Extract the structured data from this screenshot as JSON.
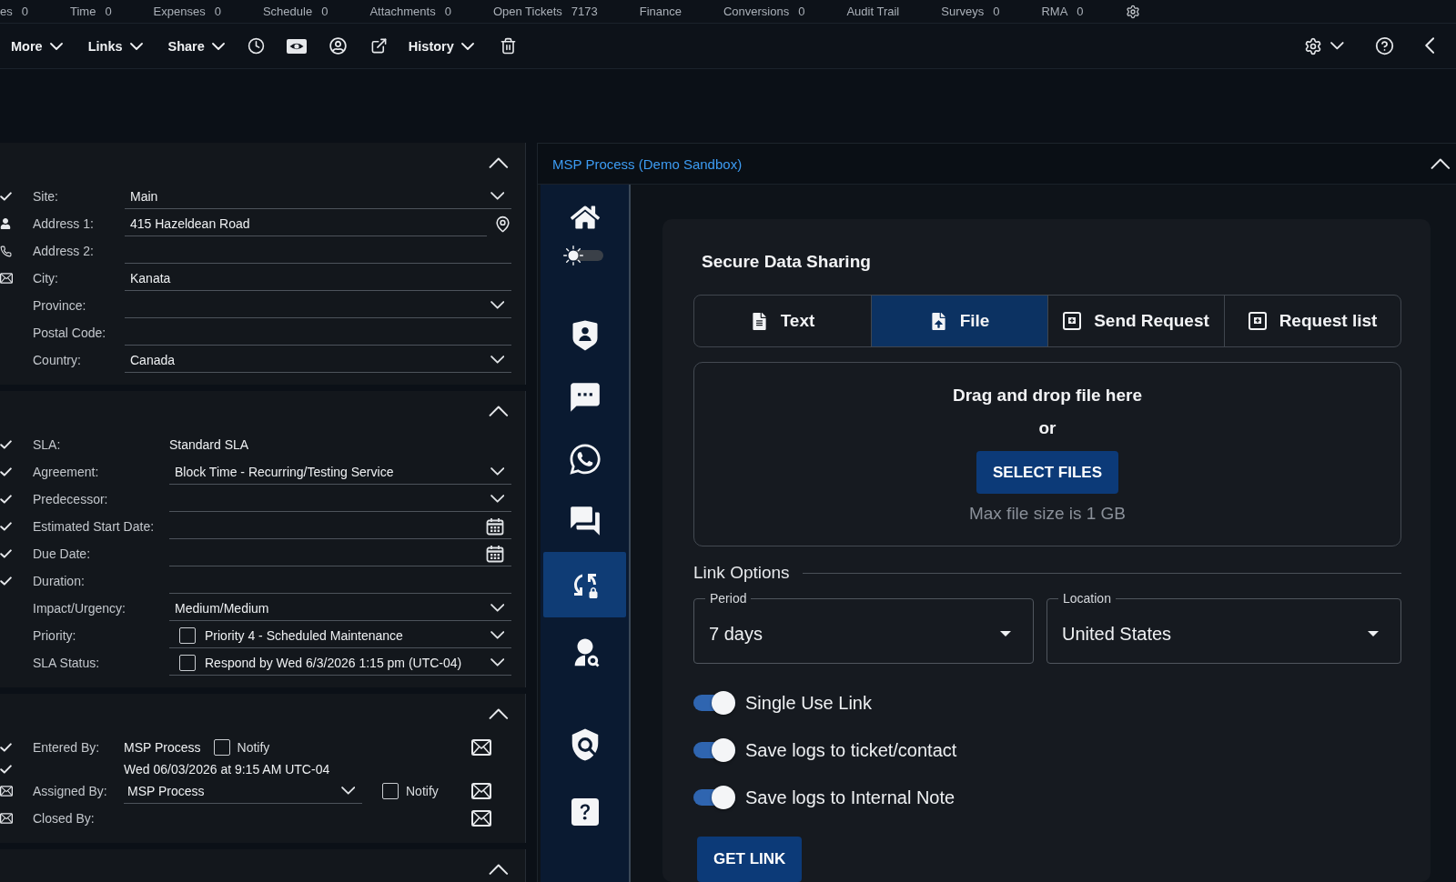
{
  "module_tabs": [
    {
      "label": "es",
      "count": "0"
    },
    {
      "label": "Time",
      "count": "0"
    },
    {
      "label": "Expenses",
      "count": "0"
    },
    {
      "label": "Schedule",
      "count": "0"
    },
    {
      "label": "Attachments",
      "count": "0"
    },
    {
      "label": "Open Tickets",
      "count": "7173"
    },
    {
      "label": "Finance"
    },
    {
      "label": "Conversions",
      "count": "0"
    },
    {
      "label": "Audit Trail"
    },
    {
      "label": "Surveys",
      "count": "0"
    },
    {
      "label": "RMA",
      "count": "0"
    }
  ],
  "toolbar": {
    "menus": [
      "More",
      "Links",
      "Share"
    ],
    "history_menu": "History"
  },
  "sections": [
    {
      "expanded": true,
      "rows": [
        {
          "kind": "select",
          "label": "Site:",
          "value": "Main"
        },
        {
          "kind": "address",
          "label": "Address 1:",
          "value": "415 Hazeldean Road"
        },
        {
          "kind": "text",
          "label": "Address 2:"
        },
        {
          "kind": "text",
          "label": "City:",
          "value": "Kanata"
        },
        {
          "kind": "select",
          "label": "Province:"
        },
        {
          "kind": "text",
          "label": "Postal Code:"
        },
        {
          "kind": "select",
          "label": "Country:",
          "value": "Canada"
        }
      ]
    },
    {
      "expanded": true,
      "rows": [
        {
          "kind": "plain",
          "label": "SLA:",
          "value": "Standard SLA"
        },
        {
          "kind": "select",
          "label": "Agreement:",
          "value": "Block Time - Recurring/Testing Service"
        },
        {
          "kind": "select",
          "label": "Predecessor:"
        },
        {
          "kind": "date",
          "label": "Estimated Start Date:"
        },
        {
          "kind": "date",
          "label": "Due Date:"
        },
        {
          "kind": "text",
          "label": "Duration:"
        },
        {
          "kind": "select",
          "label": "Impact/Urgency:",
          "value": "Medium/Medium"
        },
        {
          "kind": "check_select",
          "label": "Priority:",
          "value": "Priority 4 - Scheduled Maintenance",
          "checked": false
        },
        {
          "kind": "check_select",
          "label": "SLA Status:",
          "value": "Respond by Wed 6/3/2026 1:15 pm (UTC-04)",
          "checked": false
        }
      ]
    },
    {
      "expanded": true,
      "rows": [
        {
          "kind": "person",
          "label": "Entered By:",
          "value": "MSP Process",
          "notify": {
            "label": "Notify",
            "checked": false
          },
          "note": "Wed 06/03/2026 at 9:15 AM UTC-04"
        },
        {
          "kind": "person_select",
          "label": "Assigned By:",
          "value": "MSP Process",
          "notify": {
            "label": "Notify",
            "checked": false
          }
        },
        {
          "kind": "person",
          "label": "Closed By:"
        }
      ]
    },
    {
      "expanded": true
    }
  ],
  "process_panel": {
    "title": "MSP Process (Demo Sandbox)",
    "expanded": true,
    "theme_toggle": {
      "on": false
    },
    "nav_items": [
      {
        "selected": false
      },
      {
        "selected": false
      },
      {
        "selected": false
      },
      {
        "selected": false
      },
      {
        "selected": false
      },
      {
        "selected": true
      },
      {
        "selected": false
      },
      {
        "selected": false
      },
      {
        "selected": false
      }
    ],
    "secure_sharing": {
      "title": "Secure Data Sharing",
      "tabs": [
        {
          "label": "Text",
          "selected": false
        },
        {
          "label": "File",
          "selected": true
        },
        {
          "label": "Send Request",
          "selected": false
        },
        {
          "label": "Request list",
          "selected": false
        }
      ],
      "dropzone": {
        "heading": "Drag and drop file here",
        "separator": "or",
        "button": "SELECT FILES",
        "note": "Max file size is 1 GB"
      },
      "link_options": {
        "legend": "Link Options",
        "fields": [
          {
            "label": "Period",
            "value": "7 days"
          },
          {
            "label": "Location",
            "value": "United States"
          }
        ],
        "toggles": [
          {
            "label": "Single Use Link",
            "on": true
          },
          {
            "label": "Save logs to ticket/contact",
            "on": true
          },
          {
            "label": "Save logs to Internal Note",
            "on": true
          }
        ]
      },
      "button": "GET LINK"
    }
  }
}
